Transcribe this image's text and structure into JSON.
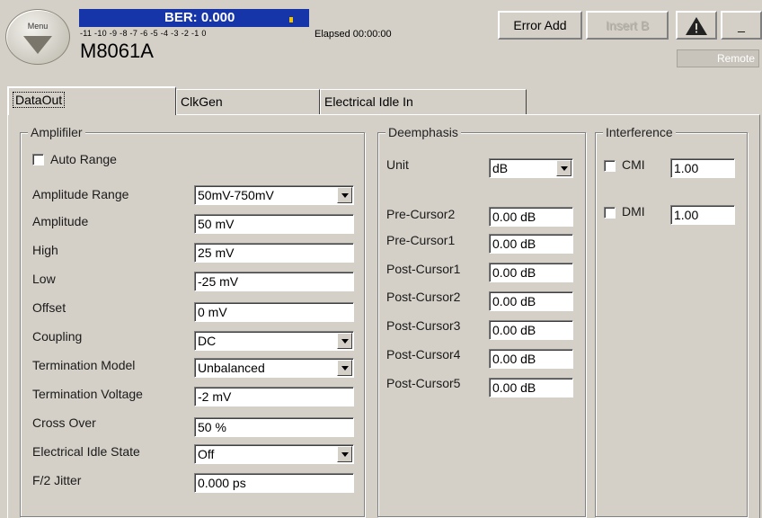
{
  "header": {
    "menu_label": "Menu",
    "ber_text": "BER: 0.000",
    "ber_scale": "-11 -10 -9 -8 -7 -6 -5 -4 -3 -2 -1 0",
    "elapsed": "Elapsed 00:00:00",
    "device": "M8061A",
    "error_add_label": "Error Add",
    "insert_b_label": "Insert B",
    "minimize_label": "_",
    "remote_label": "Remote"
  },
  "tabs": [
    {
      "label": "DataOut",
      "active": true
    },
    {
      "label": "ClkGen",
      "active": false
    },
    {
      "label": "Electrical Idle In",
      "active": false
    }
  ],
  "amplifier": {
    "title": "Amplifiler",
    "auto_range_label": "Auto Range",
    "auto_range_checked": false,
    "rows": [
      {
        "label": "Amplitude Range",
        "value": "50mV-750mV",
        "type": "select"
      },
      {
        "label": "Amplitude",
        "value": "50 mV",
        "type": "text"
      },
      {
        "label": "High",
        "value": "25 mV",
        "type": "text"
      },
      {
        "label": "Low",
        "value": "-25 mV",
        "type": "text"
      },
      {
        "label": "Offset",
        "value": "0 mV",
        "type": "text"
      },
      {
        "label": "Coupling",
        "value": "DC",
        "type": "select"
      },
      {
        "label": "Termination Model",
        "value": "Unbalanced",
        "type": "select"
      },
      {
        "label": "Termination Voltage",
        "value": "-2 mV",
        "type": "text"
      },
      {
        "label": "Cross Over",
        "value": "50 %",
        "type": "text"
      },
      {
        "label": "Electrical Idle State",
        "value": "Off",
        "type": "select"
      },
      {
        "label": "F/2 Jitter",
        "value": "0.000 ps",
        "type": "text"
      }
    ]
  },
  "deemphasis": {
    "title": "Deemphasis",
    "unit_label": "Unit",
    "unit_value": "dB",
    "rows": [
      {
        "label": "Pre-Cursor2",
        "value": "0.00 dB"
      },
      {
        "label": "Pre-Cursor1",
        "value": "0.00 dB"
      },
      {
        "label": "Post-Cursor1",
        "value": "0.00 dB"
      },
      {
        "label": "Post-Cursor2",
        "value": "0.00 dB"
      },
      {
        "label": "Post-Cursor3",
        "value": "0.00 dB"
      },
      {
        "label": "Post-Cursor4",
        "value": "0.00 dB"
      },
      {
        "label": "Post-Cursor5",
        "value": "0.00 dB"
      }
    ]
  },
  "interference": {
    "title": "Interference",
    "items": [
      {
        "label": "CMI",
        "value": "1.00",
        "checked": false
      },
      {
        "label": "DMI",
        "value": "1.00",
        "checked": false
      }
    ]
  },
  "icons": {
    "menu": "chevron-down-icon",
    "warning": "warning-icon"
  }
}
